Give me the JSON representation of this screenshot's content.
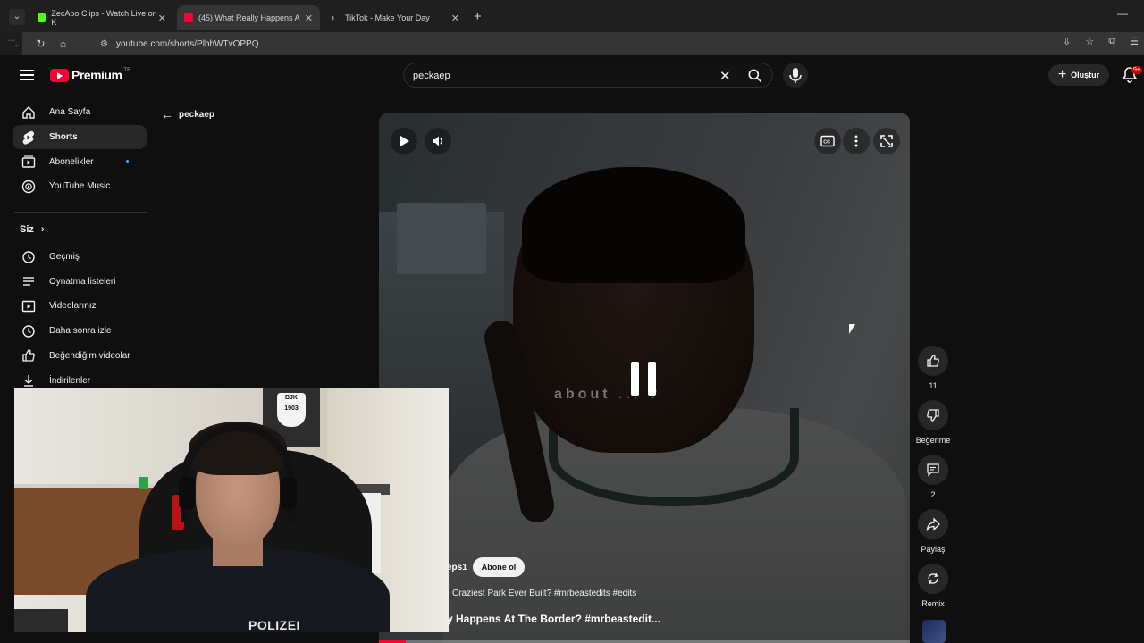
{
  "browser": {
    "tabs": [
      {
        "title": "ZecApo Clips - Watch Live on K",
        "favicon_color": "#53fc18",
        "active": false
      },
      {
        "title": "(45) What Really Happens A",
        "favicon_color": "#ff0033",
        "active": true
      },
      {
        "title": "TikTok - Make Your Day",
        "favicon_color": "#ffffff",
        "active": false
      }
    ],
    "url": "youtube.com/shorts/PlbhWTvOPPQ"
  },
  "header": {
    "logo": "Premium",
    "country": "TR",
    "search_query": "peckaep",
    "create_label": "Oluştur",
    "notif_badge": "9+"
  },
  "sidebar": {
    "main": [
      {
        "label": "Ana Sayfa",
        "icon": "home-icon"
      },
      {
        "label": "Shorts",
        "icon": "shorts-icon",
        "active": true
      },
      {
        "label": "Abonelikler",
        "icon": "subscriptions-icon",
        "dot": true
      },
      {
        "label": "YouTube Music",
        "icon": "music-icon"
      }
    ],
    "you_header": "Siz",
    "you": [
      {
        "label": "Geçmiş",
        "icon": "history-icon"
      },
      {
        "label": "Oynatma listeleri",
        "icon": "playlist-icon"
      },
      {
        "label": "Videolarınız",
        "icon": "your-videos-icon"
      },
      {
        "label": "Daha sonra izle",
        "icon": "watch-later-icon"
      },
      {
        "label": "Beğendiğim videolar",
        "icon": "liked-icon"
      },
      {
        "label": "İndirilenler",
        "icon": "download-icon"
      }
    ]
  },
  "back": {
    "label": "peckaep"
  },
  "video": {
    "overlay_text_a": "about",
    "overlay_text_b": "...",
    "overlay_text_c": "?",
    "channel": "eps1",
    "subscribe_label": "Abone ol",
    "title_line1": "Craziest Park Ever Built? #mrbeastedits #edits",
    "title_line2": "y Happens At The Border? #mrbeastedit...",
    "progress": 0.05,
    "accent": "#ff0033"
  },
  "actions": {
    "like_count": "11",
    "dislike_label": "Beğenme",
    "comment_count": "2",
    "share_label": "Paylaş",
    "remix_label": "Remix"
  },
  "webcam": {
    "shirt_text": "POLIZEI",
    "poster_text": "BJK 1903"
  }
}
